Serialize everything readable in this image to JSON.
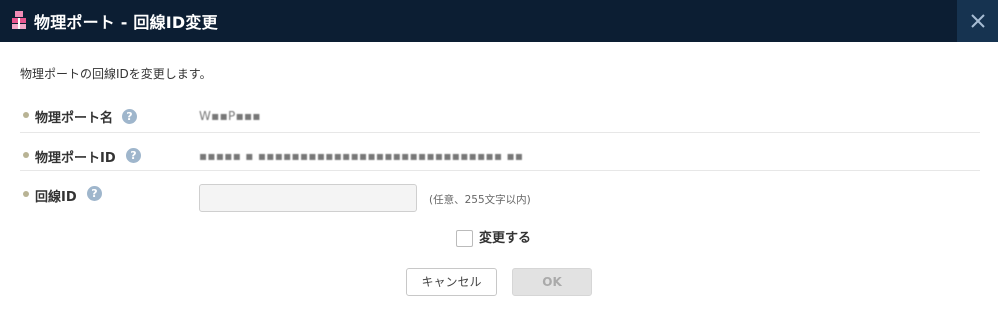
{
  "dialog": {
    "title": "物理ポート - 回線ID変更",
    "close_label": "×",
    "description": "物理ポートの回線IDを変更します。"
  },
  "fields": [
    {
      "label": "物理ポート名",
      "help": "?",
      "value": "W▪▪P▪▪▪"
    },
    {
      "label": "物理ポートID",
      "help": "?",
      "value": "▪▪▪▪▪ ▪ ▪▪▪▪▪▪▪▪▪▪▪▪▪▪▪▪▪▪▪▪▪▪▪▪▪▪▪▪▪ ▪▪"
    },
    {
      "label": "回線ID",
      "help": "?",
      "input_value": "",
      "hint": "(任意、255文字以内)"
    }
  ],
  "checkbox": {
    "label": "変更する",
    "checked": false
  },
  "buttons": {
    "cancel": "キャンセル",
    "ok": "OK"
  },
  "colors": {
    "titlebar": "#0c1e33",
    "close_bg": "#163350",
    "help_icon": "#9fb6cc",
    "bullet": "#b8b394"
  },
  "icons": {
    "title": "pink-package-icon",
    "close": "close-icon",
    "help": "question-circle-icon"
  }
}
